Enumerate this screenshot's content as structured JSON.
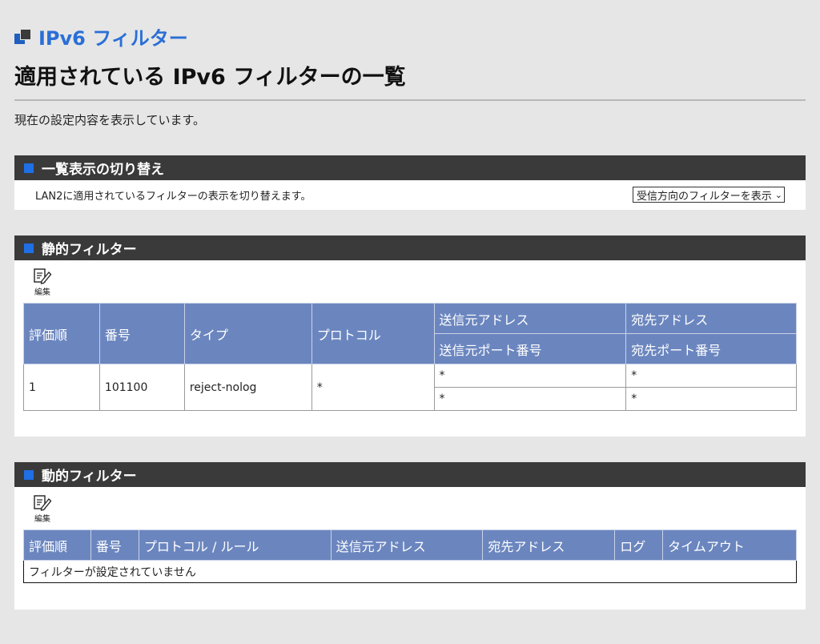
{
  "page": {
    "brand_title": "IPv6 フィルター",
    "main_title": "適用されている IPv6 フィルターの一覧",
    "description": "現在の設定内容を表示しています。"
  },
  "switch_panel": {
    "title": "一覧表示の切り替え",
    "text": "LAN2に適用されているフィルターの表示を切り替えます。",
    "select_value": "受信方向のフィルターを表示"
  },
  "static_panel": {
    "title": "静的フィルター",
    "edit_label": "編集",
    "headers": {
      "order": "評価順",
      "number": "番号",
      "type": "タイプ",
      "protocol": "プロトコル",
      "src_addr": "送信元アドレス",
      "dst_addr": "宛先アドレス",
      "src_port": "送信元ポート番号",
      "dst_port": "宛先ポート番号"
    },
    "rows": [
      {
        "order": "1",
        "number": "101100",
        "type": "reject-nolog",
        "protocol": "*",
        "src_addr": "*",
        "dst_addr": "*",
        "src_port": "*",
        "dst_port": "*"
      }
    ]
  },
  "dynamic_panel": {
    "title": "動的フィルター",
    "edit_label": "編集",
    "headers": {
      "order": "評価順",
      "number": "番号",
      "protocol_rule": "プロトコル / ルール",
      "src_addr": "送信元アドレス",
      "dst_addr": "宛先アドレス",
      "log": "ログ",
      "timeout": "タイムアウト"
    },
    "empty_message": "フィルターが設定されていません"
  },
  "colors": {
    "brand": "#2a6fd6",
    "panel_header": "#3a3a3a",
    "table_header": "#6b86bf",
    "accent_mark": "#1f6fe5"
  }
}
